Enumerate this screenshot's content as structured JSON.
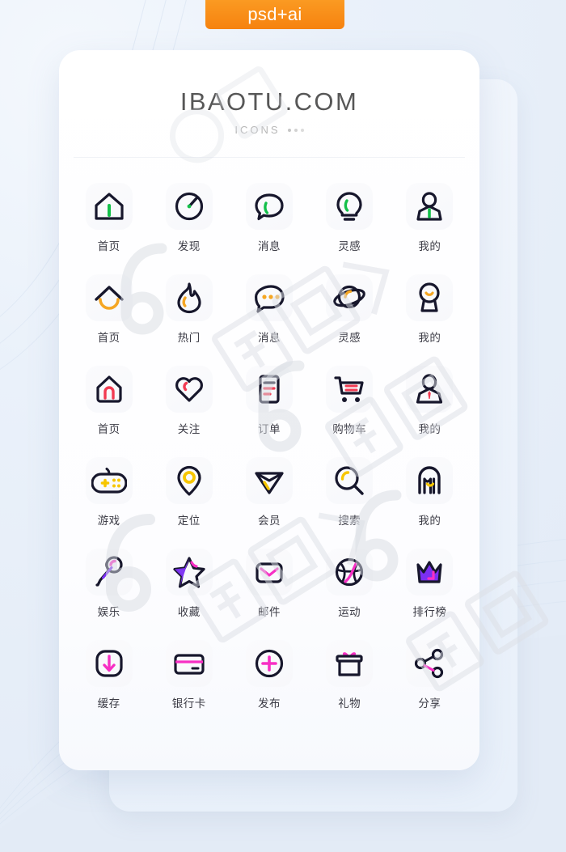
{
  "badge": {
    "label": "psd+ai"
  },
  "header": {
    "title": "IBAOTU.COM",
    "subtitle": "ICONS"
  },
  "colors": {
    "stroke": "#17172c",
    "accent_green": "#14c04a",
    "accent_orange": "#f5a623",
    "accent_yellow": "#f7c600",
    "accent_red": "#f23b52",
    "accent_magenta": "#f72fc4",
    "accent_purple": "#7b2ff2",
    "badge_bg": "#f6820f",
    "card_bg": "#ffffff",
    "page_bg": "#e9eff8",
    "label_text": "#3c3c46",
    "title_text": "#575757",
    "subtitle_text": "#b6b6b6"
  },
  "grid": {
    "columns": 5,
    "rows": 6,
    "icons": [
      {
        "label": "首页",
        "icon": "house-icon",
        "accent": "green"
      },
      {
        "label": "发现",
        "icon": "compass-icon",
        "accent": "green"
      },
      {
        "label": "消息",
        "icon": "chat-bubble-icon",
        "accent": "green"
      },
      {
        "label": "灵感",
        "icon": "lightbulb-icon",
        "accent": "green"
      },
      {
        "label": "我的",
        "icon": "user-profile-icon",
        "accent": "green"
      },
      {
        "label": "首页",
        "icon": "roof-smile-icon",
        "accent": "orange"
      },
      {
        "label": "热门",
        "icon": "flame-icon",
        "accent": "orange"
      },
      {
        "label": "消息",
        "icon": "chat-dots-icon",
        "accent": "orange"
      },
      {
        "label": "灵感",
        "icon": "planet-icon",
        "accent": "orange"
      },
      {
        "label": "我的",
        "icon": "user-smile-icon",
        "accent": "orange"
      },
      {
        "label": "首页",
        "icon": "house-arch-icon",
        "accent": "red"
      },
      {
        "label": "关注",
        "icon": "heart-icon",
        "accent": "red"
      },
      {
        "label": "订单",
        "icon": "order-document-icon",
        "accent": "red"
      },
      {
        "label": "购物车",
        "icon": "shopping-cart-icon",
        "accent": "red"
      },
      {
        "label": "我的",
        "icon": "user-tie-icon",
        "accent": "red"
      },
      {
        "label": "游戏",
        "icon": "gamepad-icon",
        "accent": "yellow"
      },
      {
        "label": "定位",
        "icon": "location-pin-icon",
        "accent": "yellow"
      },
      {
        "label": "会员",
        "icon": "diamond-icon",
        "accent": "yellow"
      },
      {
        "label": "搜索",
        "icon": "search-icon",
        "accent": "yellow"
      },
      {
        "label": "我的",
        "icon": "user-abstract-icon",
        "accent": "yellow"
      },
      {
        "label": "娱乐",
        "icon": "microphone-icon",
        "accent": "magenta"
      },
      {
        "label": "收藏",
        "icon": "star-icon",
        "accent": "magenta"
      },
      {
        "label": "邮件",
        "icon": "envelope-icon",
        "accent": "magenta"
      },
      {
        "label": "运动",
        "icon": "basketball-icon",
        "accent": "magenta"
      },
      {
        "label": "排行榜",
        "icon": "crown-icon",
        "accent": "magenta"
      },
      {
        "label": "缓存",
        "icon": "download-arrow-icon",
        "accent": "magenta"
      },
      {
        "label": "银行卡",
        "icon": "bank-card-icon",
        "accent": "magenta"
      },
      {
        "label": "发布",
        "icon": "plus-circle-icon",
        "accent": "magenta"
      },
      {
        "label": "礼物",
        "icon": "gift-box-icon",
        "accent": "magenta"
      },
      {
        "label": "分享",
        "icon": "share-nodes-icon",
        "accent": "magenta"
      }
    ]
  }
}
